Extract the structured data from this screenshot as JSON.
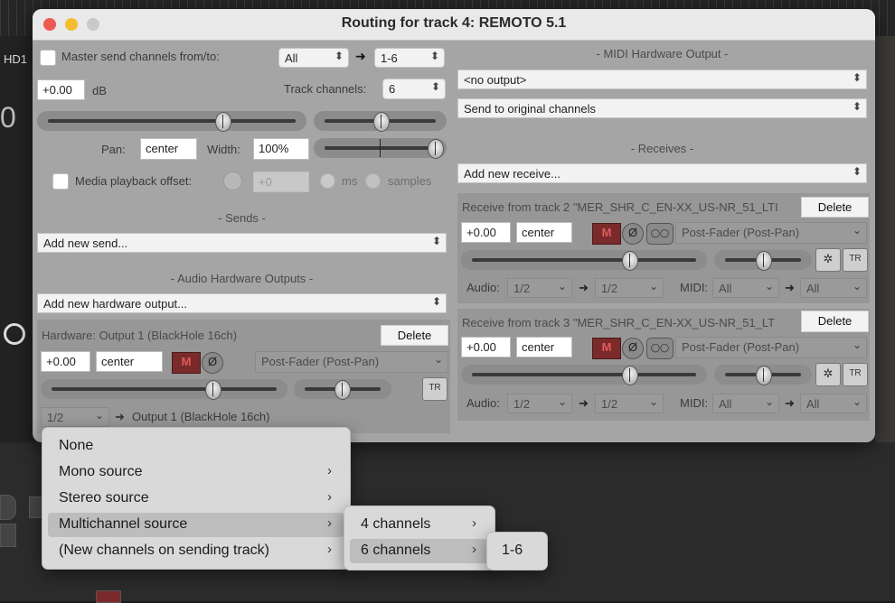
{
  "window": {
    "title": "Routing for track 4: REMOTO 5.1"
  },
  "background": {
    "track_label": "HD1",
    "counter_text": "0"
  },
  "master": {
    "send_label": "Master send channels from/to:",
    "from": "All",
    "to": "1-6",
    "volume": "+0.00",
    "db_label": "dB",
    "track_channels_label": "Track channels:",
    "track_channels": "6",
    "pan_label": "Pan:",
    "pan": "center",
    "width_label": "Width:",
    "width": "100%",
    "media_offset_label": "Media playback offset:",
    "offset_value": "+0",
    "ms_label": "ms",
    "samples_label": "samples"
  },
  "sends": {
    "header": "Sends",
    "add_label": "Add new send..."
  },
  "audio_hw": {
    "header": "Audio Hardware Outputs",
    "add_label": "Add new hardware output...",
    "output": {
      "title": "Hardware: Output 1 (BlackHole 16ch)",
      "delete": "Delete",
      "volume": "+0.00",
      "pan": "center",
      "mute": "M",
      "phase": "Ø",
      "mode": "Post-Fader (Post-Pan)",
      "channel": "1/2",
      "dest": "Output 1 (BlackHole 16ch)",
      "tr": "TR"
    }
  },
  "midi_hw": {
    "header": "MIDI Hardware Output",
    "output": "<no output>",
    "channels": "Send to original channels"
  },
  "receives": {
    "header": "Receives",
    "add_label": "Add new receive...",
    "items": [
      {
        "title": "Receive from track 2 \"MER_SHR_C_EN-XX_US-NR_51_LTI",
        "delete": "Delete",
        "volume": "+0.00",
        "pan": "center",
        "mute": "M",
        "phase": "Ø",
        "mono": "◯◯",
        "mode": "Post-Fader (Post-Pan)",
        "audio_label": "Audio:",
        "audio_src": "1/2",
        "audio_dst": "1/2",
        "midi_label": "MIDI:",
        "midi_src": "All",
        "midi_dst": "All",
        "tr": "TR"
      },
      {
        "title": "Receive from track 3 \"MER_SHR_C_EN-XX_US-NR_51_LT",
        "delete": "Delete",
        "volume": "+0.00",
        "pan": "center",
        "mute": "M",
        "phase": "Ø",
        "mono": "◯◯",
        "mode": "Post-Fader (Post-Pan)",
        "audio_label": "Audio:",
        "audio_src": "1/2",
        "audio_dst": "1/2",
        "midi_label": "MIDI:",
        "midi_src": "All",
        "midi_dst": "All",
        "tr": "TR"
      }
    ]
  },
  "menu": {
    "items": [
      {
        "label": "None"
      },
      {
        "label": "Mono source"
      },
      {
        "label": "Stereo source"
      },
      {
        "label": "Multichannel source"
      },
      {
        "label": "(New channels on sending track)"
      }
    ],
    "submenu": [
      {
        "label": "4 channels"
      },
      {
        "label": "6 channels"
      }
    ],
    "subsubmenu": [
      {
        "label": "1-6"
      }
    ]
  },
  "icons": {
    "chevron": "›",
    "updown": "⌃⌄",
    "arrow_right": "➜"
  }
}
